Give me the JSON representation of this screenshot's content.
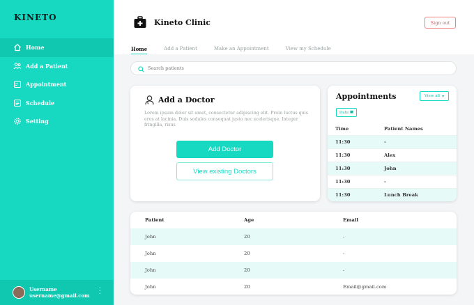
{
  "sidebar": {
    "brand": "KINETO",
    "items": [
      {
        "label": "Home",
        "icon": "home-icon",
        "active": true
      },
      {
        "label": "Add a Patient",
        "icon": "users-icon",
        "active": false
      },
      {
        "label": "Appointment",
        "icon": "appointment-icon",
        "active": false
      },
      {
        "label": "Schedule",
        "icon": "schedule-icon",
        "active": false
      },
      {
        "label": "Setting",
        "icon": "gear-icon",
        "active": false
      }
    ],
    "user": {
      "name": "Username",
      "email": "username@gmail.com"
    }
  },
  "header": {
    "clinic_name": "Kineto Clinic",
    "signout_label": "Sign out",
    "tabs": [
      "Home",
      "Add a Patient",
      "Make an Appointment",
      "View my Schedule"
    ]
  },
  "search": {
    "placeholder": "Search patients"
  },
  "add_doctor": {
    "title": "Add a Doctor",
    "description": "Lorem ipsum dolor sit amet, consectetur adipiscing elit. Proin luctus quis eros at lacinia. Duis sodales consequat justo nec scelerisque. Integer fringilla, risus",
    "add_label": "Add Doctor",
    "view_label": "View existing Doctors"
  },
  "appointments": {
    "title": "Appointments",
    "view_all_label": "View all",
    "date_label": "Date",
    "columns": [
      "Time",
      "Patient Names"
    ],
    "rows": [
      {
        "time": "11:30",
        "patient": "-"
      },
      {
        "time": "11:30",
        "patient": "Alex"
      },
      {
        "time": "11:30",
        "patient": "John"
      },
      {
        "time": "11:30",
        "patient": "-"
      },
      {
        "time": "11:30",
        "patient": "Lunch Break"
      }
    ]
  },
  "patients": {
    "columns": [
      "Patient",
      "Age",
      "Email"
    ],
    "rows": [
      {
        "name": "John",
        "age": "20",
        "email": "-"
      },
      {
        "name": "John",
        "age": "20",
        "email": "-"
      },
      {
        "name": "John",
        "age": "20",
        "email": "-"
      },
      {
        "name": "John",
        "age": "20",
        "email": "Email@gmail.com"
      }
    ]
  },
  "colors": {
    "accent": "#17d9c2",
    "accent_dark": "#10c7b0",
    "row_alt": "#e6fbf8",
    "signout": "#e25555"
  }
}
